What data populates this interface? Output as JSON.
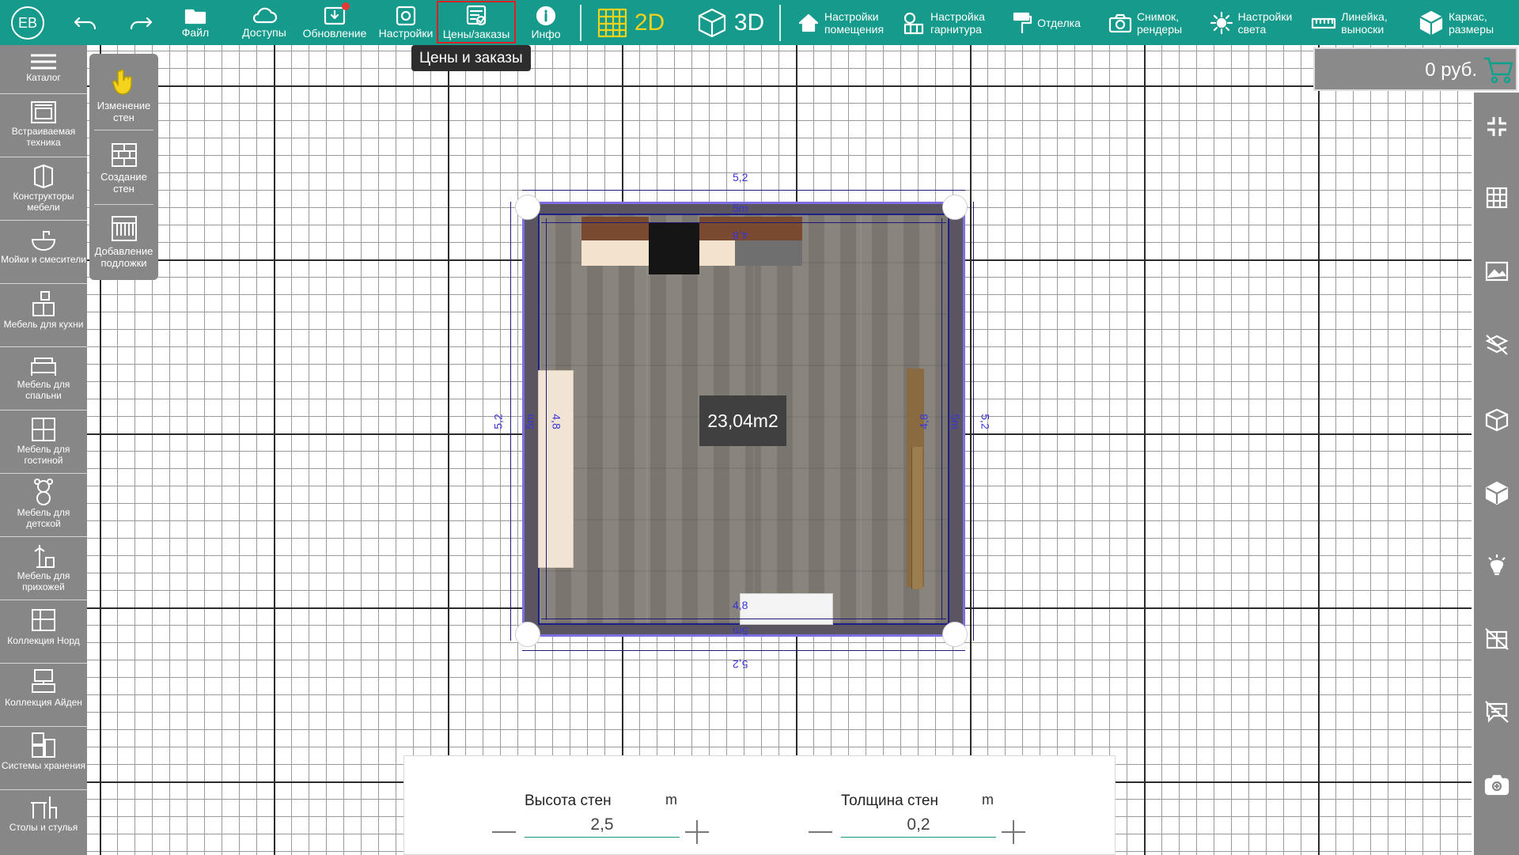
{
  "header": {
    "avatar_initials": "EB",
    "toolbar": [
      {
        "label": "Файл",
        "icon": "folder-icon"
      },
      {
        "label": "Доступы",
        "icon": "cloud-icon"
      },
      {
        "label": "Обновление",
        "icon": "download-update-icon"
      },
      {
        "label": "Настройки",
        "icon": "gear-icon"
      },
      {
        "label": "Цены/заказы",
        "icon": "price-list-icon"
      },
      {
        "label": "Инфо",
        "icon": "info-icon"
      }
    ],
    "modes": {
      "two_d": "2D",
      "three_d": "3D"
    },
    "settings": [
      {
        "label1": "Настройки",
        "label2": "помещения",
        "icon": "home-icon"
      },
      {
        "label1": "Настройка",
        "label2": "гарнитура",
        "icon": "gear-cabinet-icon"
      },
      {
        "label1": "Отделка",
        "label2": "",
        "icon": "paint-roller-icon"
      },
      {
        "label1": "Снимок,",
        "label2": "рендеры",
        "icon": "camera-icon"
      },
      {
        "label1": "Настройки",
        "label2": "света",
        "icon": "light-icon"
      },
      {
        "label1": "Линейка,",
        "label2": "выноски",
        "icon": "ruler-icon"
      },
      {
        "label1": "Каркас,",
        "label2": "размеры",
        "icon": "box-icon"
      }
    ]
  },
  "tooltip": "Цены и заказы",
  "sidebar": {
    "items": [
      {
        "label": "Каталог",
        "icon": "menu-icon"
      },
      {
        "label": "Встраиваемая техника",
        "icon": "oven-icon"
      },
      {
        "label": "Конструкторы мебели",
        "icon": "furniture-builder-icon"
      },
      {
        "label": "Мойки и смесители",
        "icon": "sink-icon"
      },
      {
        "label": "Мебель для кухни",
        "icon": "kitchen-icon"
      },
      {
        "label": "Мебель для спальни",
        "icon": "bed-icon"
      },
      {
        "label": "Мебель для гостиной",
        "icon": "cabinet-icon"
      },
      {
        "label": "Мебель для детской",
        "icon": "teddy-bear-icon"
      },
      {
        "label": "Мебель для прихожей",
        "icon": "hanger-icon"
      },
      {
        "label": "Коллекция Норд",
        "icon": "shelf-icon"
      },
      {
        "label": "Коллекция Айден",
        "icon": "tv-stand-icon"
      },
      {
        "label": "Системы хранения",
        "icon": "storage-icon"
      },
      {
        "label": "Столы и стулья",
        "icon": "table-chair-icon"
      }
    ]
  },
  "subpanel": {
    "items": [
      {
        "label": "Изменение стен",
        "icon": "hand-pointer-icon"
      },
      {
        "label": "Создание стен",
        "icon": "brick-wall-icon"
      },
      {
        "label": "Добавление подложки",
        "icon": "underlay-icon"
      }
    ]
  },
  "room": {
    "area": "23,04m2",
    "dims": {
      "outer_top": "5,2",
      "outer_bottom": "5,2",
      "outer_left": "5,2",
      "outer_right": "5,2",
      "mid_top": "5m",
      "mid_bottom": "5m",
      "mid_left": "5m",
      "mid_right": "5m",
      "inner_top": "4,8",
      "inner_bottom": "4,8",
      "inner_left": "4,8",
      "inner_right": "4,8"
    }
  },
  "price": "0 руб.",
  "rightbar": {
    "icons": [
      "collapse-icon",
      "grid-icon",
      "image-icon",
      "hide-floor-icon",
      "box-open-icon",
      "cube-icon",
      "lamp-icon",
      "hide-walls-icon",
      "hide-comments-icon",
      "camera-add-icon"
    ]
  },
  "bottom": {
    "height_label": "Высота стен",
    "height_unit": "m",
    "height_value": "2,5",
    "thickness_label": "Толщина стен",
    "thickness_unit": "m",
    "thickness_value": "0,2"
  },
  "colors": {
    "topbar": "#159a8b",
    "sidebar": "#878787",
    "mode_active": "#f1d21c",
    "wall_highlight": "#7c6fe0",
    "tooltip": "#2d2d2d"
  }
}
